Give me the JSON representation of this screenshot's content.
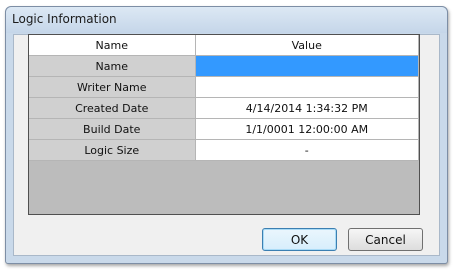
{
  "window": {
    "title": "Logic Information"
  },
  "grid": {
    "headers": {
      "name": "Name",
      "value": "Value"
    },
    "rows": [
      {
        "name": "Name",
        "value": ""
      },
      {
        "name": "Writer Name",
        "value": ""
      },
      {
        "name": "Created Date",
        "value": "4/14/2014 1:34:32 PM"
      },
      {
        "name": "Build Date",
        "value": "1/1/0001 12:00:00 AM"
      },
      {
        "name": "Logic Size",
        "value": "-"
      }
    ],
    "selected_row_index": 0,
    "selection_color": "#3399ff"
  },
  "buttons": {
    "ok": "OK",
    "cancel": "Cancel"
  }
}
